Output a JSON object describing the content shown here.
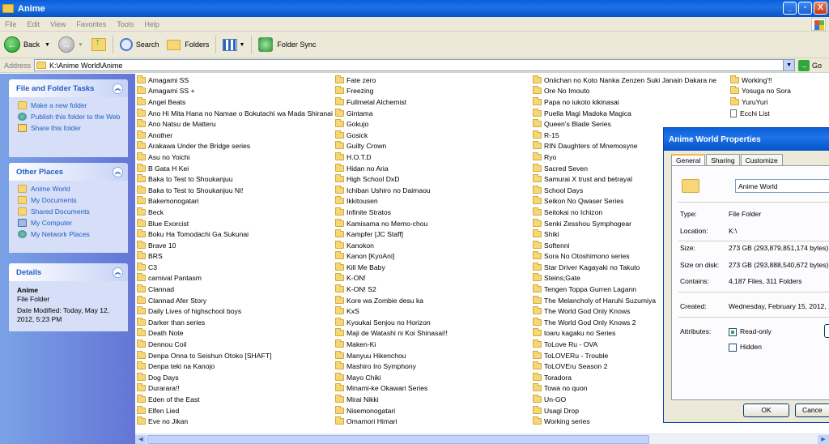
{
  "window": {
    "title": "Anime",
    "min_label": "_",
    "max_label": "▫",
    "close_label": "X"
  },
  "menu": [
    "File",
    "Edit",
    "View",
    "Favorites",
    "Tools",
    "Help"
  ],
  "toolbar": {
    "back": "Back",
    "search": "Search",
    "folders": "Folders",
    "folder_sync": "Folder Sync"
  },
  "address": {
    "label": "Address",
    "path": "K:\\Anime World\\Anime",
    "go": "Go"
  },
  "tasks_panel": {
    "file_folder_tasks": {
      "title": "File and Folder Tasks",
      "items": [
        "Make a new folder",
        "Publish this folder to the Web",
        "Share this folder"
      ]
    },
    "other_places": {
      "title": "Other Places",
      "items": [
        "Anime World",
        "My Documents",
        "Shared Documents",
        "My Computer",
        "My Network Places"
      ]
    },
    "details": {
      "title": "Details",
      "name": "Anime",
      "type": "File Folder",
      "modified": "Date Modified: Today, May 12, 2012, 5:23 PM"
    }
  },
  "files": {
    "col1": [
      "Amagami SS",
      "Amagami SS +",
      "Angel Beats",
      "Ano Hi Mita Hana no Namae o Bokutachi wa Mada Shiranai",
      "Ano Natsu de Matteru",
      "Another",
      "Arakawa Under the Bridge series",
      "Asu no Yoichi",
      "B Gata H Kei",
      "Baka to Test to Shoukanjuu",
      "Baka to Test to Shoukanjuu Ni!",
      "Bakemonogatari",
      "Beck",
      "Blue Exorcist",
      "Boku Ha Tomodachi Ga Sukunai",
      "Brave 10",
      "BRS",
      "C3",
      "carnival Pantasm",
      "Clannad",
      "Clannad Afer Story",
      "Daily Lives of highschool boys",
      "Darker than series",
      "Death Note",
      "Dennou Coil",
      "Denpa Onna to Seishun Otoko [SHAFT]",
      "Denpa teki na Kanojo",
      "Dog Days",
      "Durarara!!",
      "Eden of the East",
      "Elfen Lied",
      "Eve no Jikan"
    ],
    "col2": [
      "Fate zero",
      "Freezing",
      "Fullmetal Alchemist",
      "Gintama",
      "Gokujo",
      "Gosick",
      "Guilty Crown",
      "H.O.T.D",
      "Hidan no Aria",
      "High School DxD",
      "Ichiban Ushiro no Daimaou",
      "Ikkitousen",
      "Infinite Stratos",
      "Kamisama no Memo-chou",
      "Kampfer [JC Staff]",
      "Kanokon",
      "Kanon [KyoAni]",
      "Kill Me Baby",
      "K-ON!",
      "K-ON! S2",
      "Kore wa Zombie desu ka",
      "KxS",
      "Kyoukai Senjou no Horizon",
      "Maji de Watashi ni Koi Shinasai!!",
      "Maken-Ki",
      "Manyuu Hikenchou",
      "Mashiro Iro Symphony",
      "Mayo Chiki",
      "Minami-ke Okawari Series",
      "Mirai Nikki",
      "Nisemonogatari",
      "Omamori Himari"
    ],
    "col3": [
      "Oniichan no Koto Nanka Zenzen Suki Janain Dakara ne",
      "Ore No Imouto",
      "Papa no iukoto kikinasai",
      "Puella Magi Madoka Magica",
      "Queen's Blade Series",
      "R-15",
      "RIN Daughters of Mnemosyne",
      "Ryo",
      "Sacred Seven",
      "Samurai X trust and betrayal",
      "School Days",
      "Seikon No Qwaser Series",
      "Seitokai no Ichizon",
      "Senki Zesshou Symphogear",
      "Shiki",
      "Softenni",
      "Sora No Otoshimono series",
      "Star Driver Kagayaki no Takuto",
      "Steins;Gate",
      "Tengen Toppa Gurren Lagann",
      "The Melancholy of Haruhi Suzumiya",
      "The World God Only Knows",
      "The World God Only Knows 2",
      "toaru kagaku no Series",
      "ToLove Ru - OVA",
      "ToLOVERu - Trouble",
      "ToLOVEru Season 2",
      "Toradora",
      "Towa no quon",
      "Un-GO",
      "Usagi Drop",
      "Working series"
    ],
    "col4": [
      "Working'!!",
      "Yosuga no Sora",
      "YuruYuri"
    ],
    "col4_file": "Ecchi List"
  },
  "properties": {
    "title": "Anime World Properties",
    "tabs": [
      "General",
      "Sharing",
      "Customize"
    ],
    "name": "Anime World",
    "type_label": "Type:",
    "type": "File Folder",
    "location_label": "Location:",
    "location": "K:\\",
    "size_label": "Size:",
    "size": "273 GB (293,879,851,174 bytes)",
    "size_disk_label": "Size on disk:",
    "size_disk": "273 GB (293,888,540,672 bytes)",
    "contains_label": "Contains:",
    "contains": "4,187 Files, 311 Folders",
    "created_label": "Created:",
    "created": "Wednesday, February 15, 2012, 1",
    "attributes_label": "Attributes:",
    "readonly": "Read-only",
    "hidden": "Hidden",
    "ok": "OK",
    "cancel": "Cance"
  }
}
